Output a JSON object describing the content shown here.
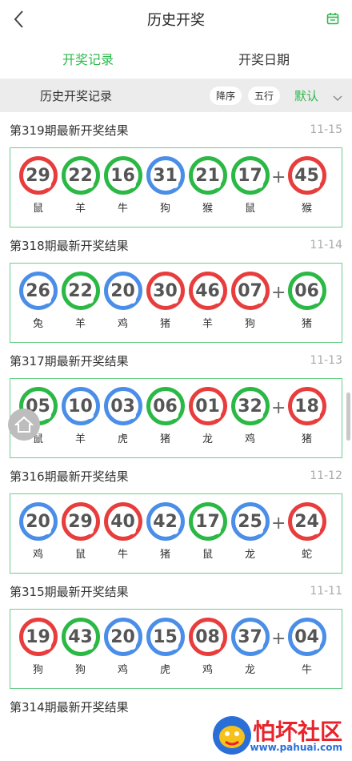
{
  "header": {
    "title": "历史开奖"
  },
  "tabs": [
    "开奖记录",
    "开奖日期"
  ],
  "filter": {
    "title": "历史开奖记录",
    "sort": "降序",
    "mode": "五行",
    "default": "默认"
  },
  "records": [
    {
      "title": "第319期最新开奖结果",
      "date": "11-15",
      "balls": [
        {
          "num": "29",
          "zodiac": "鼠",
          "color": "red"
        },
        {
          "num": "22",
          "zodiac": "羊",
          "color": "green"
        },
        {
          "num": "16",
          "zodiac": "牛",
          "color": "green"
        },
        {
          "num": "31",
          "zodiac": "狗",
          "color": "blue"
        },
        {
          "num": "21",
          "zodiac": "猴",
          "color": "green"
        },
        {
          "num": "17",
          "zodiac": "鼠",
          "color": "green"
        },
        {
          "num": "45",
          "zodiac": "猴",
          "color": "red"
        }
      ]
    },
    {
      "title": "第318期最新开奖结果",
      "date": "11-14",
      "balls": [
        {
          "num": "26",
          "zodiac": "兔",
          "color": "blue"
        },
        {
          "num": "22",
          "zodiac": "羊",
          "color": "green"
        },
        {
          "num": "20",
          "zodiac": "鸡",
          "color": "blue"
        },
        {
          "num": "30",
          "zodiac": "猪",
          "color": "red"
        },
        {
          "num": "46",
          "zodiac": "羊",
          "color": "red"
        },
        {
          "num": "07",
          "zodiac": "狗",
          "color": "red"
        },
        {
          "num": "06",
          "zodiac": "猪",
          "color": "green"
        }
      ]
    },
    {
      "title": "第317期最新开奖结果",
      "date": "11-13",
      "balls": [
        {
          "num": "05",
          "zodiac": "鼠",
          "color": "green"
        },
        {
          "num": "10",
          "zodiac": "羊",
          "color": "blue"
        },
        {
          "num": "03",
          "zodiac": "虎",
          "color": "blue"
        },
        {
          "num": "06",
          "zodiac": "猪",
          "color": "green"
        },
        {
          "num": "01",
          "zodiac": "龙",
          "color": "red"
        },
        {
          "num": "32",
          "zodiac": "鸡",
          "color": "green"
        },
        {
          "num": "18",
          "zodiac": "猪",
          "color": "red"
        }
      ]
    },
    {
      "title": "第316期最新开奖结果",
      "date": "11-12",
      "balls": [
        {
          "num": "20",
          "zodiac": "鸡",
          "color": "blue"
        },
        {
          "num": "29",
          "zodiac": "鼠",
          "color": "red"
        },
        {
          "num": "40",
          "zodiac": "牛",
          "color": "red"
        },
        {
          "num": "42",
          "zodiac": "猪",
          "color": "blue"
        },
        {
          "num": "17",
          "zodiac": "鼠",
          "color": "green"
        },
        {
          "num": "25",
          "zodiac": "龙",
          "color": "blue"
        },
        {
          "num": "24",
          "zodiac": "蛇",
          "color": "red"
        }
      ]
    },
    {
      "title": "第315期最新开奖结果",
      "date": "11-11",
      "balls": [
        {
          "num": "19",
          "zodiac": "狗",
          "color": "red"
        },
        {
          "num": "43",
          "zodiac": "狗",
          "color": "green"
        },
        {
          "num": "20",
          "zodiac": "鸡",
          "color": "blue"
        },
        {
          "num": "15",
          "zodiac": "虎",
          "color": "blue"
        },
        {
          "num": "08",
          "zodiac": "鸡",
          "color": "red"
        },
        {
          "num": "37",
          "zodiac": "龙",
          "color": "blue"
        },
        {
          "num": "04",
          "zodiac": "牛",
          "color": "blue"
        }
      ]
    },
    {
      "title": "第314期最新开奖结果",
      "date": "",
      "balls": []
    }
  ],
  "watermark": {
    "name": "怕坏社区",
    "url": "www.pahuai.com"
  }
}
